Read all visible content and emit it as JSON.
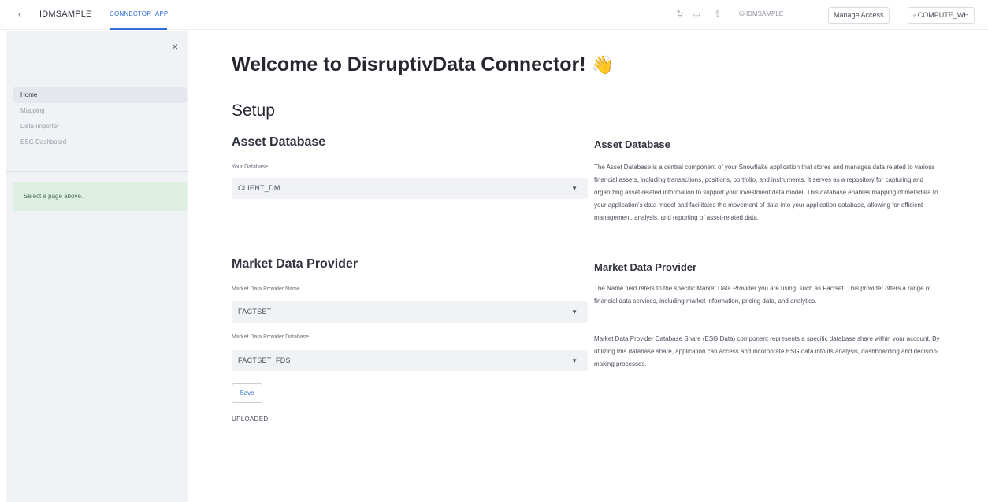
{
  "topbar": {
    "back_icon": "chevron-left-icon",
    "app_name": "IDMSAMPLE",
    "app_tab": "CONNECTOR_APP",
    "database_label": "IDMSAMPLE",
    "manage_access_label": "Manage Access",
    "warehouse_label": "COMPUTE_WH"
  },
  "sidebar": {
    "items": [
      {
        "label": "Home",
        "active": true
      },
      {
        "label": "Mapping",
        "active": false
      },
      {
        "label": "Data Importer",
        "active": false
      },
      {
        "label": "ESG Dashboard",
        "active": false
      }
    ],
    "note": "Select a page above."
  },
  "main": {
    "title": "Welcome to DisruptivData Connector!",
    "title_emoji": "👋",
    "setup_heading": "Setup",
    "asset_db": {
      "heading": "Asset Database",
      "field_label": "Your Database",
      "value": "CLIENT_DM"
    },
    "market_data": {
      "heading": "Market Data Provider",
      "provider_name_label": "Market Data Provider Name",
      "provider_name_value": "FACTSET",
      "provider_db_label": "Market Data Provider Database",
      "provider_db_value": "FACTSET_FDS"
    },
    "save_label": "Save",
    "status_text": "UPLOADED"
  },
  "info": {
    "asset_db_heading": "Asset Database",
    "asset_db_text": "The Asset Database is a central component of your Snowflake application that stores and manages data related to various financial assets, including transactions, positions, portfolio, and instruments. It serves as a repository for capturing and organizing asset-related information to support your investment data model. This database enables mapping of metadata to your application's data model and facilitates the movement of data into your application database, allowing for efficient management, analysis, and reporting of asset-related data.",
    "market_heading": "Market Data Provider",
    "market_text_1": "The Name field refers to the specific Market Data Provider you are using, such as Factset. This provider offers a range of financial data services, including market information, pricing data, and analytics.",
    "market_text_2": "Market Data Provider Database Share (ESG Data) component represents a specific database share within your account. By utilizing this database share, application can access and incorporate ESG data into its analysis, dashboarding and decision-making processes."
  }
}
